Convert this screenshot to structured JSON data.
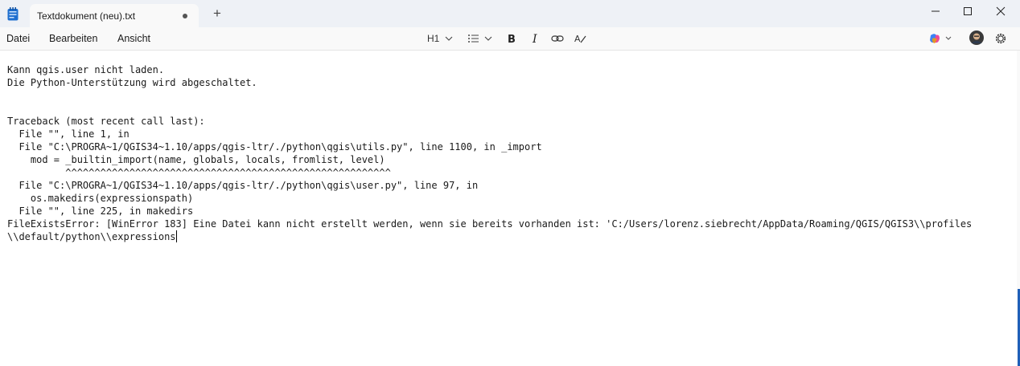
{
  "tab": {
    "title": "Textdokument (neu).txt"
  },
  "menu": [
    "Datei",
    "Bearbeiten",
    "Ansicht"
  ],
  "toolbar": {
    "heading": "H1"
  },
  "icons": {
    "app": "notepad-icon",
    "new_tab": "plus-icon",
    "minimize": "minimize-icon",
    "maximize": "maximize-icon",
    "close": "close-icon",
    "list": "list-icon",
    "bold": "bold-icon",
    "italic": "italic-icon",
    "link": "link-icon",
    "clear_format": "clear-formatting-icon",
    "copilot": "copilot-icon",
    "profile": "avatar",
    "settings": "gear-icon"
  },
  "document": {
    "lines": [
      "Kann qgis.user nicht laden.",
      "Die Python-Unterstützung wird abgeschaltet.",
      "",
      "",
      "Traceback (most recent call last):",
      "  File \"\", line 1, in",
      "  File \"C:\\PROGRA~1/QGIS34~1.10/apps/qgis-ltr/./python\\qgis\\utils.py\", line 1100, in _import",
      "    mod = _builtin_import(name, globals, locals, fromlist, level)",
      "          ^^^^^^^^^^^^^^^^^^^^^^^^^^^^^^^^^^^^^^^^^^^^^^^^^^^^^^^^",
      "  File \"C:\\PROGRA~1/QGIS34~1.10/apps/qgis-ltr/./python\\qgis\\user.py\", line 97, in",
      "    os.makedirs(expressionspath)",
      "  File \"\", line 225, in makedirs",
      "FileExistsError: [WinError 183] Eine Datei kann nicht erstellt werden, wenn sie bereits vorhanden ist: 'C:/Users/lorenz.siebrecht/AppData/Roaming/QGIS/QGIS3\\\\profiles",
      "\\\\default/python\\\\expressions"
    ]
  }
}
